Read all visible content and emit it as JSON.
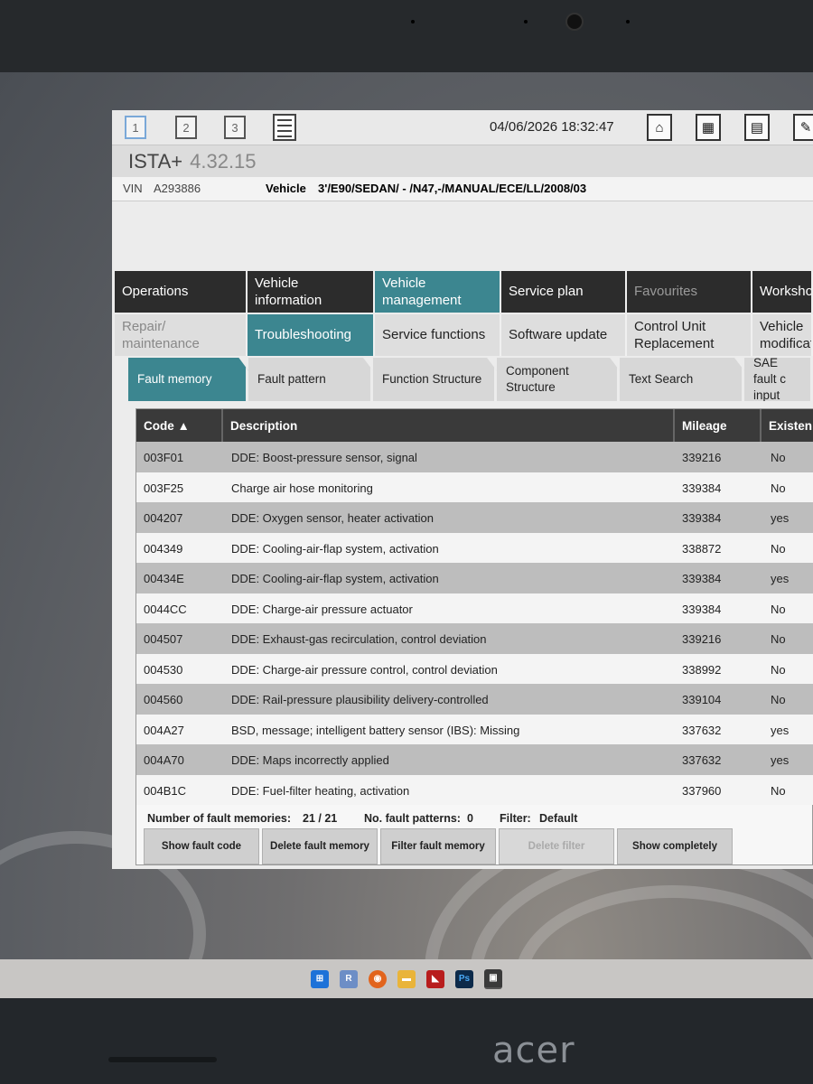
{
  "toolbar": {
    "session_buttons": [
      "1",
      "2",
      "3"
    ],
    "datetime": "04/06/2026 18:32:47"
  },
  "app": {
    "name": "ISTA+",
    "version": "4.32.15"
  },
  "vehicle_bar": {
    "vin_label": "VIN",
    "vin": "A293886",
    "vehicle_label": "Vehicle",
    "vehicle": "3'/E90/SEDAN/ - /N47,-/MANUAL/ECE/LL/2008/03"
  },
  "main_nav": [
    {
      "label": "Operations",
      "state": "dark"
    },
    {
      "label": "Vehicle information",
      "state": "dark"
    },
    {
      "label": "Vehicle management",
      "state": "teal"
    },
    {
      "label": "Service plan",
      "state": "dark"
    },
    {
      "label": "Favourites",
      "state": "dim"
    },
    {
      "label": "Workshop Operating",
      "state": "dark"
    }
  ],
  "sub_nav": [
    {
      "label": "Repair/ maintenance",
      "state": "grey"
    },
    {
      "label": "Troubleshooting",
      "state": "teal"
    },
    {
      "label": "Service functions",
      "state": "light"
    },
    {
      "label": "Software update",
      "state": "light"
    },
    {
      "label": "Control Unit Replacement",
      "state": "light"
    },
    {
      "label": "Vehicle modificat",
      "state": "light"
    }
  ],
  "tabs": [
    {
      "label": "Fault memory",
      "active": true
    },
    {
      "label": "Fault pattern",
      "active": false
    },
    {
      "label": "Function Structure",
      "active": false
    },
    {
      "label": "Component Structure",
      "active": false
    },
    {
      "label": "Text Search",
      "active": false
    },
    {
      "label": "SAE fault c input",
      "active": false
    }
  ],
  "table": {
    "headers": {
      "code": "Code ▲",
      "description": "Description",
      "mileage": "Mileage",
      "existing": "Existen"
    },
    "rows": [
      {
        "code": "003F01",
        "description": "DDE: Boost-pressure sensor, signal",
        "mileage": "339216",
        "existing": "No"
      },
      {
        "code": "003F25",
        "description": "Charge air hose monitoring",
        "mileage": "339384",
        "existing": "No"
      },
      {
        "code": "004207",
        "description": "DDE: Oxygen sensor, heater activation",
        "mileage": "339384",
        "existing": "yes"
      },
      {
        "code": "004349",
        "description": "DDE: Cooling-air-flap system, activation",
        "mileage": "338872",
        "existing": "No"
      },
      {
        "code": "00434E",
        "description": "DDE: Cooling-air-flap system, activation",
        "mileage": "339384",
        "existing": "yes"
      },
      {
        "code": "0044CC",
        "description": "DDE: Charge-air pressure actuator",
        "mileage": "339384",
        "existing": "No"
      },
      {
        "code": "004507",
        "description": "DDE: Exhaust-gas recirculation, control deviation",
        "mileage": "339216",
        "existing": "No"
      },
      {
        "code": "004530",
        "description": "DDE: Charge-air pressure control, control deviation",
        "mileage": "338992",
        "existing": "No"
      },
      {
        "code": "004560",
        "description": "DDE: Rail-pressure plausibility delivery-controlled",
        "mileage": "339104",
        "existing": "No"
      },
      {
        "code": "004A27",
        "description": "BSD, message; intelligent battery sensor (IBS): Missing",
        "mileage": "337632",
        "existing": "yes"
      },
      {
        "code": "004A70",
        "description": "DDE: Maps incorrectly applied",
        "mileage": "337632",
        "existing": "yes"
      },
      {
        "code": "004B1C",
        "description": "DDE: Fuel-filter heating, activation",
        "mileage": "337960",
        "existing": "No"
      }
    ]
  },
  "footer": {
    "count_label": "Number of fault memories:",
    "count_value": "21 / 21",
    "patterns_label": "No. fault patterns:",
    "patterns_value": "0",
    "filter_label": "Filter:",
    "filter_value": "Default"
  },
  "actions": [
    {
      "label": "Show fault code",
      "enabled": true
    },
    {
      "label": "Delete fault memory",
      "enabled": true
    },
    {
      "label": "Filter fault memory",
      "enabled": true
    },
    {
      "label": "Delete filter",
      "enabled": false
    },
    {
      "label": "Show completely",
      "enabled": true
    }
  ],
  "device": {
    "brand": "acer"
  },
  "taskbar_icons": [
    "windows-start-icon",
    "r-app-icon",
    "firefox-icon",
    "file-explorer-icon",
    "amd-icon",
    "photoshop-icon",
    "ista-app-icon"
  ]
}
